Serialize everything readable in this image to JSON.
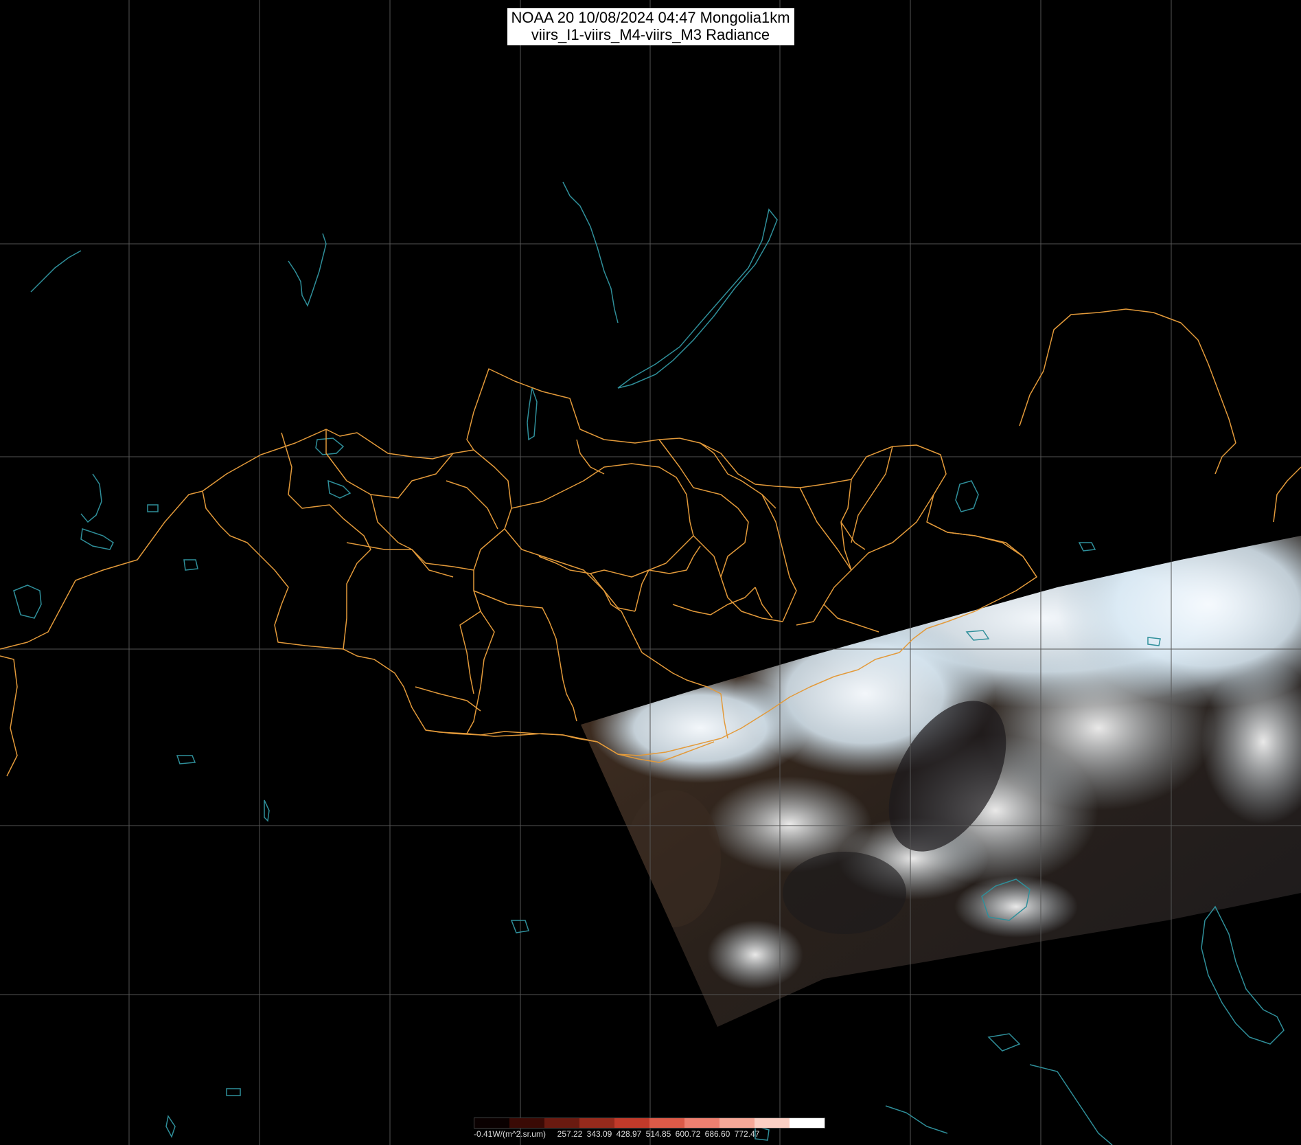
{
  "header": {
    "title_line1": "NOAA 20 10/08/2024 04:47 Mongolia1km",
    "title_line2": "viirs_I1-viirs_M4-viirs_M3 Radiance"
  },
  "legend": {
    "colors": [
      "#0a0000",
      "#3a0a05",
      "#6a1a10",
      "#962a1c",
      "#c03a2a",
      "#dc5a48",
      "#ee8070",
      "#f6a898",
      "#fbcfc4",
      "#ffffff"
    ],
    "ticks": [
      "-0.41W/(m^2.sr.um)",
      "257.22",
      "343.09",
      "428.97",
      "514.85",
      "600.72",
      "686.60",
      "772.47"
    ]
  },
  "map_colors": {
    "background": "#000000",
    "grid": "#555555",
    "province_borders": "#e39a3a",
    "water_features": "#2f8f9a",
    "clouds": "#eaf6ff",
    "land_in_swath": "#3b2b20"
  }
}
